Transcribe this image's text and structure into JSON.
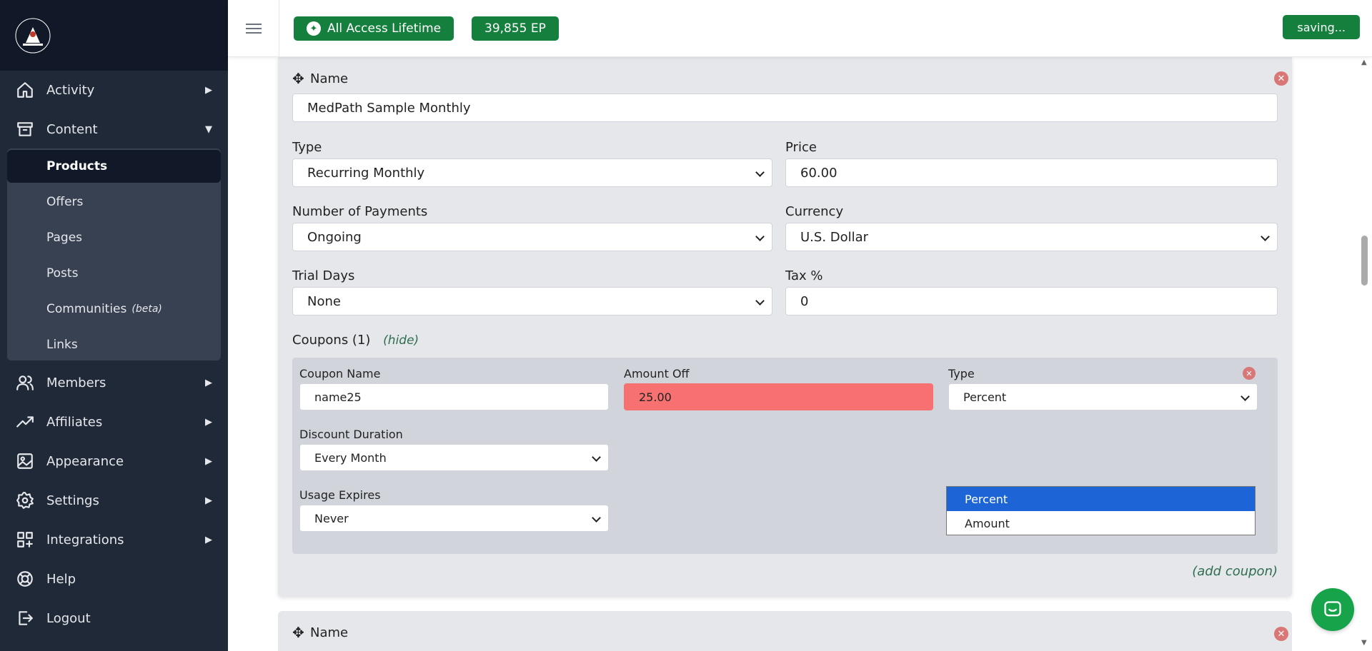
{
  "topbar": {
    "access_badge": "All Access Lifetime",
    "ep_badge": "39,855 EP",
    "saving_label": "saving..."
  },
  "sidebar": {
    "items": [
      {
        "label": "Activity",
        "icon": "home-icon",
        "arrow": "▶"
      },
      {
        "label": "Content",
        "icon": "archive-icon",
        "arrow": "▼"
      },
      {
        "label": "Members",
        "icon": "users-icon",
        "arrow": "▶"
      },
      {
        "label": "Affiliates",
        "icon": "trending-icon",
        "arrow": "▶"
      },
      {
        "label": "Appearance",
        "icon": "image-icon",
        "arrow": "▶"
      },
      {
        "label": "Settings",
        "icon": "gear-icon",
        "arrow": "▶"
      },
      {
        "label": "Integrations",
        "icon": "grid-plus-icon",
        "arrow": "▶"
      },
      {
        "label": "Help",
        "icon": "lifebuoy-icon",
        "arrow": ""
      },
      {
        "label": "Logout",
        "icon": "logout-icon",
        "arrow": ""
      }
    ],
    "content_sub": [
      {
        "label": "Products"
      },
      {
        "label": "Offers"
      },
      {
        "label": "Pages"
      },
      {
        "label": "Posts"
      },
      {
        "label": "Communities",
        "badge": "(beta)"
      },
      {
        "label": "Links"
      }
    ]
  },
  "product": {
    "name_label": "Name",
    "name_value": "MedPath Sample Monthly",
    "type_label": "Type",
    "type_value": "Recurring Monthly",
    "price_label": "Price",
    "price_value": "60.00",
    "payments_label": "Number of Payments",
    "payments_value": "Ongoing",
    "currency_label": "Currency",
    "currency_value": "U.S. Dollar",
    "trial_label": "Trial Days",
    "trial_value": "None",
    "tax_label": "Tax %",
    "tax_value": "0",
    "coupons_label": "Coupons (1)",
    "hide_label": "(hide)",
    "add_coupon_label": "(add coupon)"
  },
  "coupon": {
    "name_label": "Coupon Name",
    "name_value": "name25",
    "amount_label": "Amount Off",
    "amount_value": "25.00",
    "type_label": "Type",
    "type_value": "Percent",
    "duration_label": "Discount Duration",
    "duration_value": "Every Month",
    "expires_label": "Usage Expires",
    "expires_value": "Never",
    "type_options": [
      "Percent",
      "Amount"
    ]
  },
  "product2": {
    "name_label": "Name"
  },
  "colors": {
    "sidebar_bg": "#1f2937",
    "accent_green": "#15803d",
    "error_red": "#f87171",
    "select_blue": "#1d64d7"
  }
}
